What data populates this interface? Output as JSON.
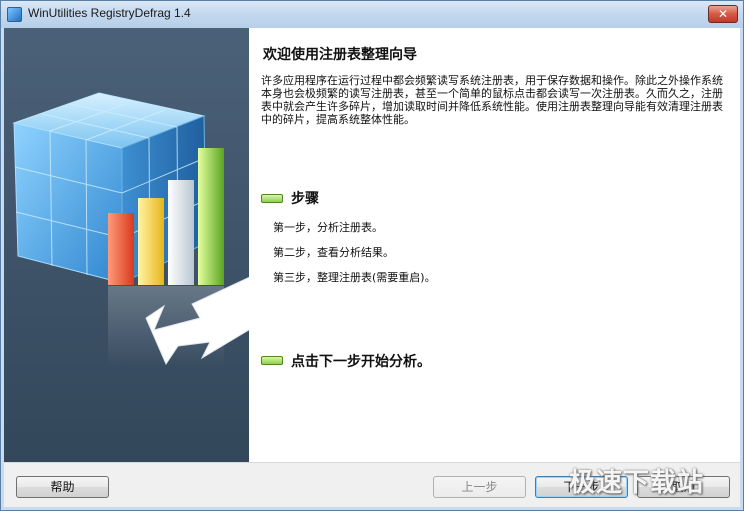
{
  "window": {
    "title": "WinUtilities RegistryDefrag 1.4",
    "close_label": "✕"
  },
  "content": {
    "heading": "欢迎使用注册表整理向导",
    "intro": "许多应用程序在运行过程中都会频繁读写系统注册表，用于保存数据和操作。除此之外操作系统本身也会极频繁的读写注册表，甚至一个简单的鼠标点击都会读写一次注册表。久而久之，注册表中就会产生许多碎片，增加读取时间并降低系统性能。使用注册表整理向导能有效清理注册表中的碎片，提高系统整体性能。",
    "steps_title": "步骤",
    "steps": [
      "第一步，分析注册表。",
      "第二步，查看分析结果。",
      "第三步，整理注册表(需要重启)。"
    ],
    "cta": "点击下一步开始分析。"
  },
  "buttons": {
    "help": "帮助",
    "back": "上一步",
    "next": "下一步",
    "cancel": "取消"
  },
  "watermark": "极速下载站",
  "colors": {
    "sidebar": "#3d5166",
    "bullet": "#8fd14b",
    "close": "#c1392a"
  }
}
